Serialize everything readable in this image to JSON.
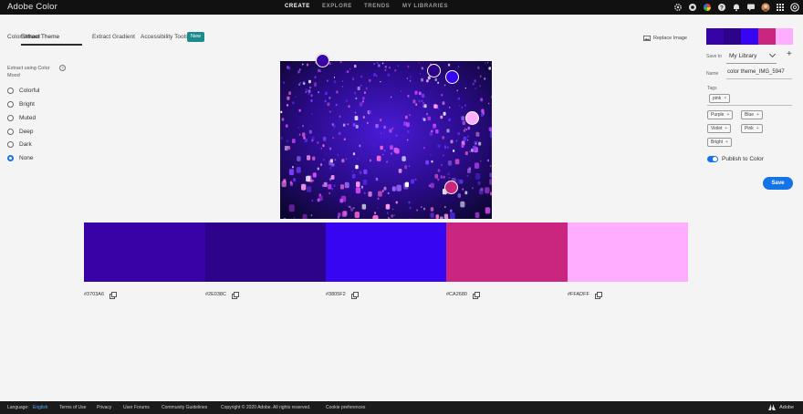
{
  "app": {
    "title": "Adobe Color"
  },
  "topnav": [
    "CREATE",
    "EXPLORE",
    "TRENDS",
    "MY LIBRARIES"
  ],
  "topicons": [
    "settings-icon",
    "creative-cloud-icon",
    "color-wheel-icon",
    "help-icon",
    "notification-icon",
    "chat-icon",
    "avatar",
    "apps-grid-icon",
    "adobe-cc-icon"
  ],
  "tabs": [
    "Color Wheel",
    "Extract Theme",
    "Extract Gradient",
    "Accessibility Tools"
  ],
  "new_badge": "New",
  "replace_image": "Replace Image",
  "mood": {
    "label": "Extract using Color Mood",
    "options": [
      "Colorful",
      "Bright",
      "Muted",
      "Deep",
      "Dark",
      "None"
    ],
    "selected": "None"
  },
  "swatches": [
    {
      "hex": "#3703A6"
    },
    {
      "hex": "#2E038C"
    },
    {
      "hex": "#3805F2"
    },
    {
      "hex": "#CA2680"
    },
    {
      "hex": "#FFADFF"
    }
  ],
  "panel": {
    "save_to_label": "Save to",
    "save_to_value": "My Library",
    "name_label": "Name",
    "name_value": "color theme_IMG_5947",
    "tags_label": "Tags",
    "applied_tags": [
      "pink"
    ],
    "suggested_tags": [
      "Purple",
      "Blue",
      "Violet",
      "Pink",
      "Bright"
    ],
    "publish_label": "Publish to Color",
    "publish_on": true,
    "save_label": "Save"
  },
  "footer": {
    "language_label": "Language:",
    "language_value": "English",
    "links": [
      "Terms of Use",
      "Privacy",
      "User Forums",
      "Community Guidelines",
      "Copyright © 2020 Adobe. All rights reserved.",
      "Cookie preferences"
    ],
    "brand": "Adobe"
  },
  "colors": {
    "accent": "#1473e6",
    "badge": "#1d8b8c",
    "topbar": "#111111",
    "footer": "#1b1b1b"
  }
}
